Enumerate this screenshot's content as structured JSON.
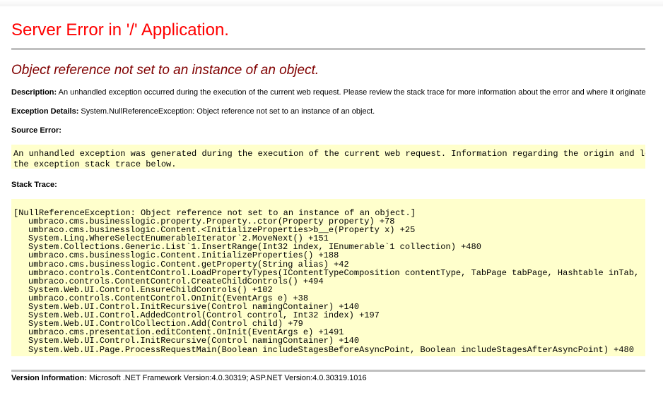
{
  "error": {
    "title": "Server Error in '/' Application.",
    "message": "Object reference not set to an instance of an object.",
    "description_label": "Description:",
    "description_text": "An unhandled exception occurred during the execution of the current web request. Please review the stack trace for more information about the error and where it originated in the code.",
    "details_label": "Exception Details:",
    "details_text": "System.NullReferenceException: Object reference not set to an instance of an object.",
    "source_label": "Source Error:",
    "source_lines": [
      "An unhandled exception was generated during the execution of the current web request. Information regarding the origin and location of",
      "the exception stack trace below."
    ],
    "stack_label": "Stack Trace:",
    "stack_header": "[NullReferenceException: Object reference not set to an instance of an object.]",
    "stack_frames": [
      "umbraco.cms.businesslogic.property.Property..ctor(Property property) +78",
      "umbraco.cms.businesslogic.Content.<InitializeProperties>b__e(Property x) +25",
      "System.Linq.WhereSelectEnumerableIterator`2.MoveNext() +151",
      "System.Collections.Generic.List`1.InsertRange(Int32 index, IEnumerable`1 collection) +480",
      "umbraco.cms.businesslogic.Content.InitializeProperties() +188",
      "umbraco.cms.businesslogic.Content.getProperty(String alias) +42",
      "umbraco.controls.ContentControl.LoadPropertyTypes(IContentTypeComposition contentType, TabPage tabPage, Hashtable inTab,",
      "umbraco.controls.ContentControl.CreateChildControls() +494",
      "System.Web.UI.Control.EnsureChildControls() +102",
      "umbraco.controls.ContentControl.OnInit(EventArgs e) +38",
      "System.Web.UI.Control.InitRecursive(Control namingContainer) +140",
      "System.Web.UI.Control.AddedControl(Control control, Int32 index) +197",
      "System.Web.UI.ControlCollection.Add(Control child) +79",
      "umbraco.cms.presentation.editContent.OnInit(EventArgs e) +1491",
      "System.Web.UI.Control.InitRecursive(Control namingContainer) +140",
      "System.Web.UI.Page.ProcessRequestMain(Boolean includeStagesBeforeAsyncPoint, Boolean includeStagesAfterAsyncPoint) +480"
    ],
    "version_label": "Version Information:",
    "version_text": "Microsoft .NET Framework Version:4.0.30319; ASP.NET Version:4.0.30319.1016"
  },
  "colors": {
    "title": "#ff0000",
    "message": "#800000",
    "code_background": "#ffffcc",
    "rule": "#c0c0c0"
  }
}
